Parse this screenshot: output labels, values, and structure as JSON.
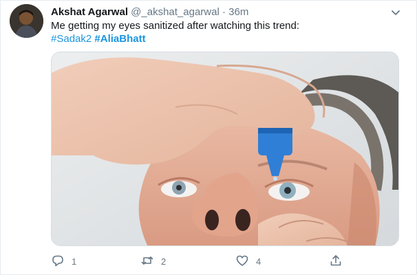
{
  "tweet": {
    "author_name": "Akshat Agarwal",
    "author_handle": "@_akshat_agarwal",
    "separator": "·",
    "time": "36m",
    "text": "Me getting my eyes sanitized after watching this trend:",
    "hashtags": [
      "#Sadak2",
      "#AliaBhatt"
    ]
  },
  "actions": {
    "reply_count": "1",
    "retweet_count": "2",
    "like_count": "4"
  },
  "colors": {
    "link": "#1b95e0",
    "muted": "#657786",
    "dropper": "#2f7fd6"
  },
  "icons": [
    "chevron-down-icon",
    "reply-icon",
    "retweet-icon",
    "like-icon",
    "share-icon"
  ]
}
